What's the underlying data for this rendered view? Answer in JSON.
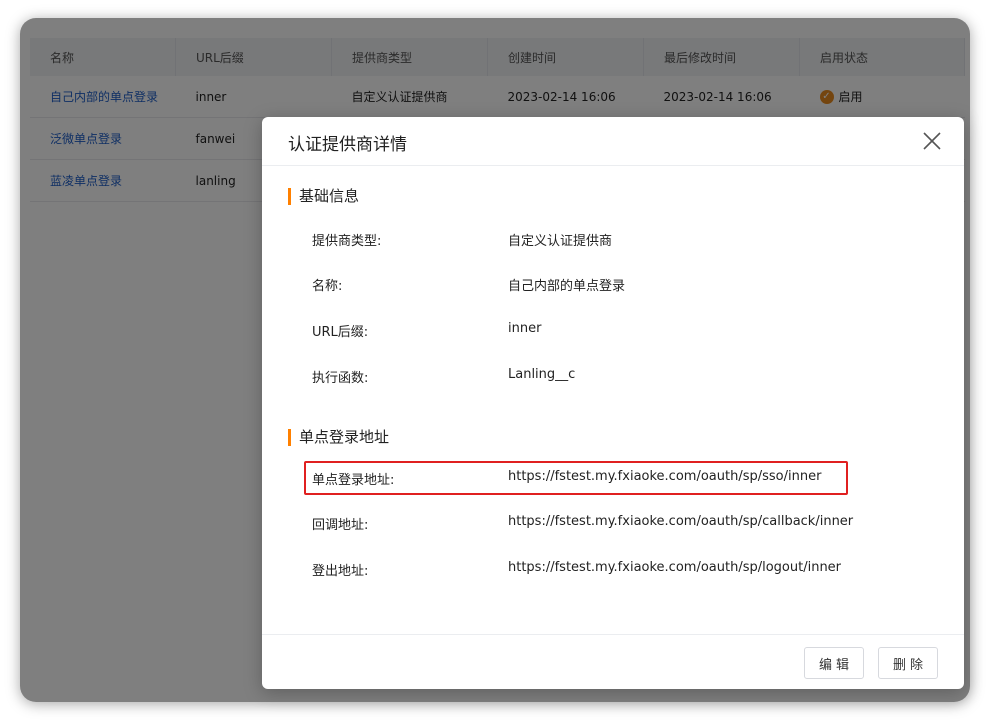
{
  "table": {
    "headers": [
      "名称",
      "URL后缀",
      "提供商类型",
      "创建时间",
      "最后修改时间",
      "启用状态"
    ],
    "rows": [
      {
        "name": "自己内部的单点登录",
        "suffix": "inner",
        "type": "自定义认证提供商",
        "created": "2023-02-14 16:06",
        "modified": "2023-02-14 16:06",
        "status": "启用"
      },
      {
        "name": "泛微单点登录",
        "suffix": "fanwei"
      },
      {
        "name": "蓝凌单点登录",
        "suffix": "lanling"
      }
    ]
  },
  "modal": {
    "title": "认证提供商详情",
    "basic": {
      "title": "基础信息",
      "rows": [
        {
          "label": "提供商类型:",
          "value": "自定义认证提供商"
        },
        {
          "label": "名称:",
          "value": "自己内部的单点登录"
        },
        {
          "label": "URL后缀:",
          "value": "inner"
        },
        {
          "label": "执行函数:",
          "value": "Lanling__c"
        }
      ]
    },
    "sso": {
      "title": "单点登录地址",
      "rows": [
        {
          "label": "单点登录地址:",
          "value": "https://fstest.my.fxiaoke.com/oauth/sp/sso/inner"
        },
        {
          "label": "回调地址:",
          "value": "https://fstest.my.fxiaoke.com/oauth/sp/callback/inner"
        },
        {
          "label": "登出地址:",
          "value": "https://fstest.my.fxiaoke.com/oauth/sp/logout/inner"
        }
      ]
    },
    "edit_label": "编辑",
    "delete_label": "删除"
  },
  "colors": {
    "accent": "#ff8000",
    "link": "#1f5fc9",
    "highlight": "#e02020",
    "status": "#e98b1f"
  },
  "icons": {
    "close": "close-icon",
    "status": "check-circle-icon"
  }
}
